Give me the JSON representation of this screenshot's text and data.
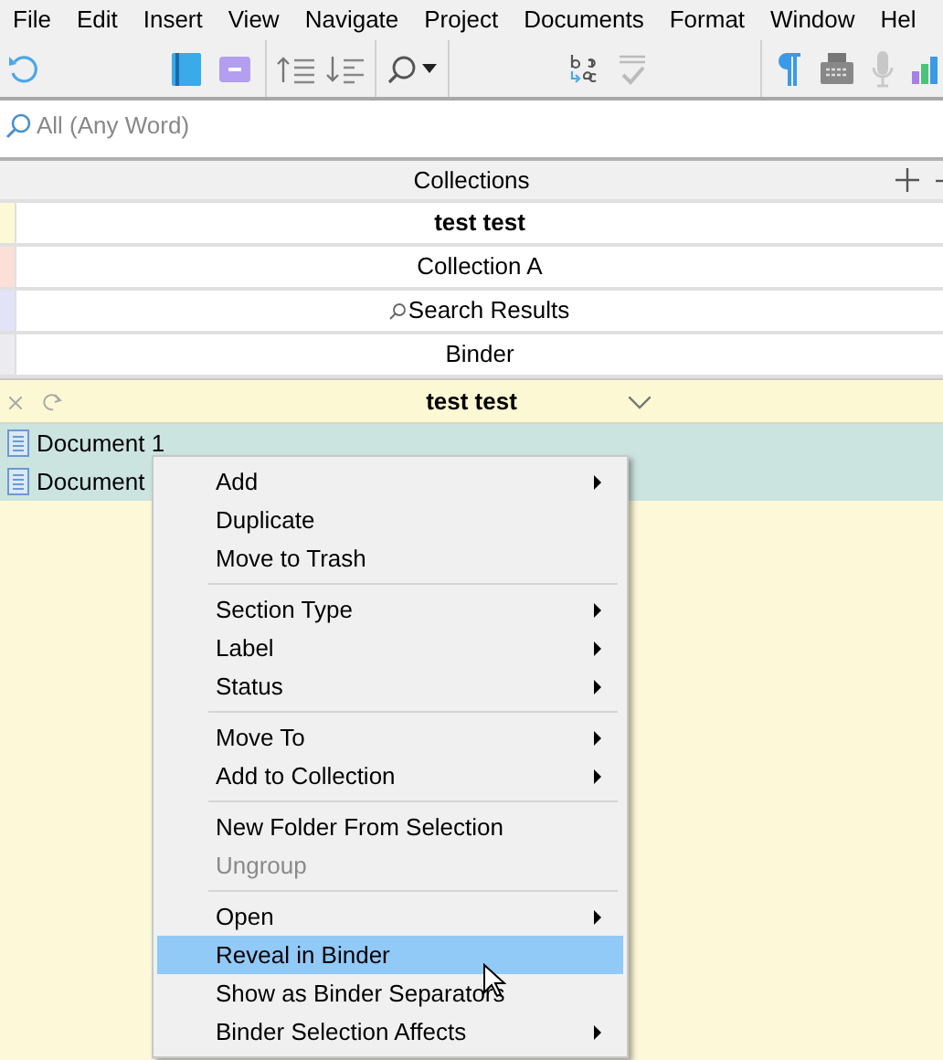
{
  "menu_bar": [
    "File",
    "Edit",
    "Insert",
    "View",
    "Navigate",
    "Project",
    "Documents",
    "Format",
    "Window",
    "Hel"
  ],
  "search": {
    "placeholder": "All (Any Word)"
  },
  "collections": {
    "title": "Collections",
    "items": [
      {
        "label": "test test",
        "color": "#fdf8d6",
        "selected": true,
        "kind": "collection"
      },
      {
        "label": "Collection A",
        "color": "#fbe0d8",
        "selected": false,
        "kind": "collection"
      },
      {
        "label": "Search Results",
        "color": "#e2e2f8",
        "selected": false,
        "kind": "search"
      },
      {
        "label": "Binder",
        "color": "#ebebf0",
        "selected": false,
        "kind": "binder"
      }
    ]
  },
  "document_header": {
    "title": "test test"
  },
  "documents": [
    {
      "name": "Document 1",
      "selected": true
    },
    {
      "name": "Document",
      "selected": true
    }
  ],
  "context_menu": [
    {
      "kind": "item",
      "label": "Add",
      "submenu": true,
      "disabled": false,
      "selected": false
    },
    {
      "kind": "item",
      "label": "Duplicate",
      "submenu": false,
      "disabled": false,
      "selected": false
    },
    {
      "kind": "item",
      "label": "Move to Trash",
      "submenu": false,
      "disabled": false,
      "selected": false
    },
    {
      "kind": "separator"
    },
    {
      "kind": "item",
      "label": "Section Type",
      "submenu": true,
      "disabled": false,
      "selected": false
    },
    {
      "kind": "item",
      "label": "Label",
      "submenu": true,
      "disabled": false,
      "selected": false
    },
    {
      "kind": "item",
      "label": "Status",
      "submenu": true,
      "disabled": false,
      "selected": false
    },
    {
      "kind": "separator"
    },
    {
      "kind": "item",
      "label": "Move To",
      "submenu": true,
      "disabled": false,
      "selected": false
    },
    {
      "kind": "item",
      "label": "Add to Collection",
      "submenu": true,
      "disabled": false,
      "selected": false
    },
    {
      "kind": "separator"
    },
    {
      "kind": "item",
      "label": "New Folder From Selection",
      "submenu": false,
      "disabled": false,
      "selected": false
    },
    {
      "kind": "item",
      "label": "Ungroup",
      "submenu": false,
      "disabled": true,
      "selected": false
    },
    {
      "kind": "separator"
    },
    {
      "kind": "item",
      "label": "Open",
      "submenu": true,
      "disabled": false,
      "selected": false
    },
    {
      "kind": "item",
      "label": "Reveal in Binder",
      "submenu": false,
      "disabled": false,
      "selected": true
    },
    {
      "kind": "item",
      "label": "Show as Binder Separators",
      "submenu": false,
      "disabled": false,
      "selected": false
    },
    {
      "kind": "item",
      "label": "Binder Selection Affects",
      "submenu": true,
      "disabled": false,
      "selected": false
    }
  ]
}
